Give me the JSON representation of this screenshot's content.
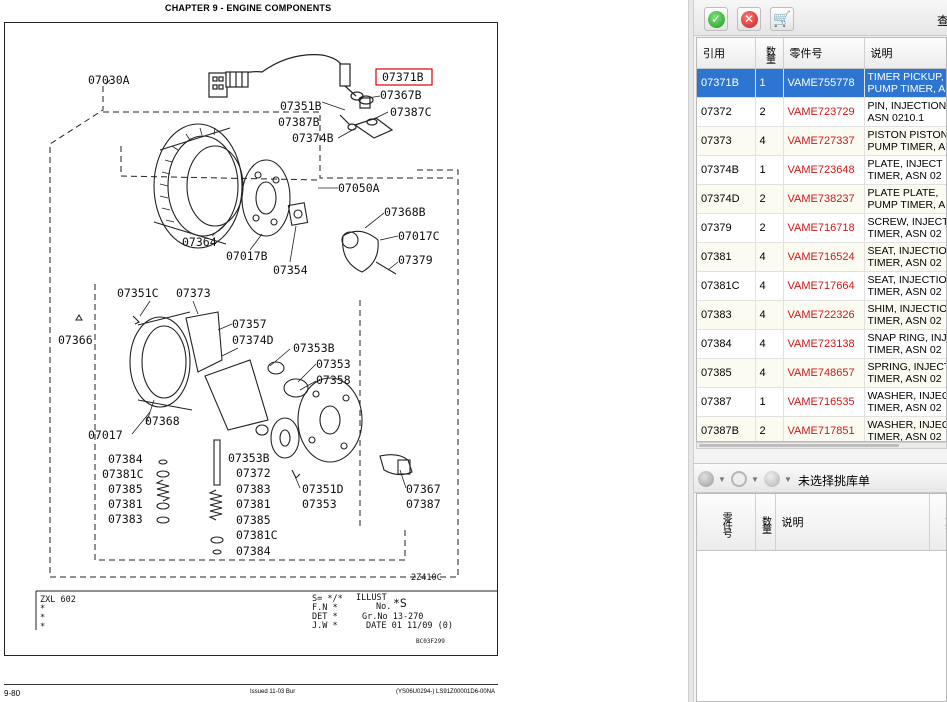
{
  "document": {
    "chapter_title": "CHAPTER 9 - ENGINE COMPONENTS",
    "page_number": "9-80",
    "issued": "Issued 11-03  Bur",
    "doc_code": "(YS06U0294-)  LS91Z00001D6-00NA",
    "diagram_code": "2Z410C",
    "small_code": "BC03F299",
    "labels": {
      "l07030A": "07030A",
      "l07371B": "07371B",
      "l07367B": "07367B",
      "l07351B": "07351B",
      "l07387C": "07387C",
      "l07387B_top": "07387B",
      "l07374B": "07374B",
      "l07050A": "07050A",
      "l07368B": "07368B",
      "l07017C": "07017C",
      "l07379": "07379",
      "l07364": "07364",
      "l07017B": "07017B",
      "l07354": "07354",
      "l07351C": "07351C",
      "l07373": "07373",
      "l07366": "07366",
      "l07357": "07357",
      "l07374D": "07374D",
      "l07353B_top": "07353B",
      "l07353": "07353",
      "l07358": "07358",
      "l07017": "07017",
      "l07368": "07368",
      "l07384_top": "07384",
      "l07381C_top": "07381C",
      "l07385_left": "07385",
      "l07381_left": "07381",
      "l07383_left": "07383",
      "l07353B_mid": "07353B",
      "l07372": "07372",
      "l07383_mid": "07383",
      "l07381_mid": "07381",
      "l07385_mid": "07385",
      "l07381C_mid": "07381C",
      "l07384_mid": "07384",
      "l07351D": "07351D",
      "l07353_bot": "07353",
      "l07367": "07367",
      "l07387": "07387"
    },
    "info_block": {
      "left_lines": [
        "ZXL  602",
        "*",
        "*",
        "*"
      ],
      "s_line": "S= */* ",
      "fn": "F.N *",
      "det": "DET *",
      "jw": "J.W *",
      "illust": "ILLUST",
      "no": "No.",
      "no_value": "*S",
      "gr_no": "Gr.No 13-270",
      "date": "DATE  01 11/09  (0)"
    }
  },
  "panel": {
    "toolbar": {
      "confirm_icon": "check-icon",
      "cancel_icon": "close-icon",
      "cart_icon": "cart-icon",
      "title_fragment": "查"
    },
    "columns": {
      "ref": "引用",
      "qty": "数量",
      "part_no": "零件号",
      "desc": "说明"
    },
    "rows": [
      {
        "ref": "07371B",
        "qty": "1",
        "part_no": "VAME755778",
        "desc": "TIMER PICKUP, PUMP TIMER, A"
      },
      {
        "ref": "07372",
        "qty": "2",
        "part_no": "VAME723729",
        "desc": "PIN, INJECTION ASN 0210.1"
      },
      {
        "ref": "07373",
        "qty": "4",
        "part_no": "VAME727337",
        "desc": "PISTON PISTON PUMP TIMER, A"
      },
      {
        "ref": "07374B",
        "qty": "1",
        "part_no": "VAME723648",
        "desc": "PLATE, INJECT TIMER, ASN 02"
      },
      {
        "ref": "07374D",
        "qty": "2",
        "part_no": "VAME738237",
        "desc": "PLATE PLATE, PUMP TIMER, A"
      },
      {
        "ref": "07379",
        "qty": "2",
        "part_no": "VAME716718",
        "desc": "SCREW, INJECT TIMER, ASN 02"
      },
      {
        "ref": "07381",
        "qty": "4",
        "part_no": "VAME716524",
        "desc": "SEAT, INJECTIO TIMER, ASN 02"
      },
      {
        "ref": "07381C",
        "qty": "4",
        "part_no": "VAME717664",
        "desc": "SEAT, INJECTIO TIMER, ASN 02"
      },
      {
        "ref": "07383",
        "qty": "4",
        "part_no": "VAME722326",
        "desc": "SHIM, INJECTIO TIMER, ASN 02"
      },
      {
        "ref": "07384",
        "qty": "4",
        "part_no": "VAME723138",
        "desc": "SNAP RING, INJ TIMER, ASN 02"
      },
      {
        "ref": "07385",
        "qty": "4",
        "part_no": "VAME748657",
        "desc": "SPRING, INJECT TIMER, ASN 02"
      },
      {
        "ref": "07387",
        "qty": "1",
        "part_no": "VAME716535",
        "desc": "WASHER, INJEC TIMER, ASN 02"
      },
      {
        "ref": "07387B",
        "qty": "2",
        "part_no": "VAME717851",
        "desc": "WASHER, INJEC TIMER, ASN 02"
      }
    ],
    "pick": {
      "label": "未选择挑库单",
      "columns": {
        "part_no": "零件号",
        "qty": "数量",
        "desc": "说明",
        "extra": "重公"
      }
    }
  }
}
